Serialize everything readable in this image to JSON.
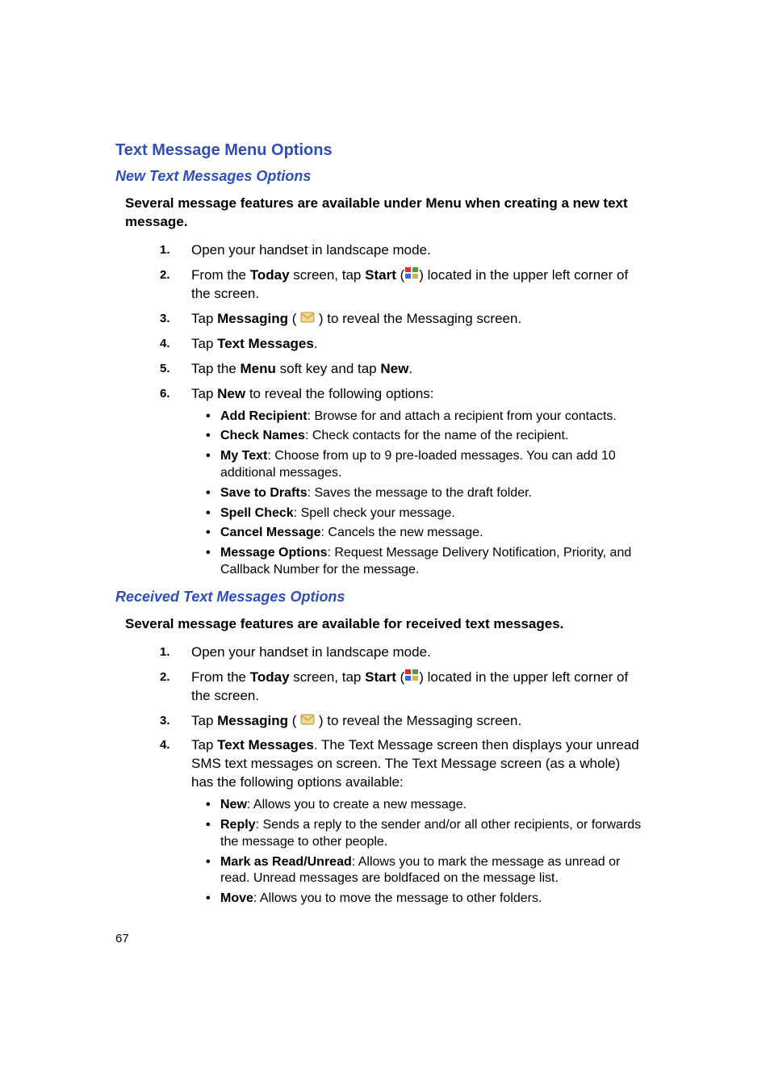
{
  "headings": {
    "main": "Text Message Menu Options",
    "sec1": "New Text Messages Options",
    "sec2": "Received Text Messages Options"
  },
  "intro": {
    "sec1": "Several message features are available under Menu when creating a new text message.",
    "sec2": "Several message features are available for received text messages."
  },
  "steps1": {
    "s1": "Open your handset in landscape mode.",
    "s2a": "From the ",
    "s2b": "Today",
    "s2c": " screen, tap ",
    "s2d": "Start",
    "s2e": " (",
    "s2f": ") located in the upper left corner of the screen.",
    "s3a": "Tap ",
    "s3b": "Messaging",
    "s3c": " ( ",
    "s3d": " ) to reveal the Messaging screen.",
    "s4a": "Tap ",
    "s4b": "Text Messages",
    "s4c": ".",
    "s5a": "Tap the ",
    "s5b": "Menu",
    "s5c": " soft key and tap ",
    "s5d": "New",
    "s5e": ".",
    "s6a": "Tap ",
    "s6b": "New",
    "s6c": " to reveal the following options:"
  },
  "bullets1": {
    "b1t": "Add Recipient",
    "b1d": ": Browse for and attach a recipient from your contacts.",
    "b2t": "Check Names",
    "b2d": ": Check contacts for the name of the recipient.",
    "b3t": "My Text",
    "b3d": ": Choose from up to 9 pre-loaded messages. You can add 10 additional messages.",
    "b4t": "Save to Drafts",
    "b4d": ": Saves the message to the draft folder.",
    "b5t": "Spell Check",
    "b5d": ": Spell check your message.",
    "b6t": "Cancel Message",
    "b6d": ": Cancels the new message.",
    "b7t": "Message Options",
    "b7d": ": Request Message Delivery Notification, Priority, and Callback Number for the message."
  },
  "steps2": {
    "s1": "Open your handset in landscape mode.",
    "s2a": "From the ",
    "s2b": "Today",
    "s2c": " screen, tap ",
    "s2d": "Start",
    "s2e": " (",
    "s2f": ") located in the upper left corner of the screen.",
    "s3a": "Tap ",
    "s3b": "Messaging",
    "s3c": " ( ",
    "s3d": " ) to reveal the Messaging screen.",
    "s4a": "Tap ",
    "s4b": "Text Messages",
    "s4c": ". The Text Message screen then displays your unread SMS text messages on screen. The Text Message screen (as a whole) has the following options available:"
  },
  "bullets2": {
    "b1t": "New",
    "b1d": ": Allows you to create a new message.",
    "b2t": "Reply",
    "b2d": ": Sends a reply to the sender and/or all other recipients, or forwards the message to other people.",
    "b3t": "Mark as Read/Unread",
    "b3d": ": Allows you to mark the message as unread or read. Unread messages are boldfaced on the message list.",
    "b4t": "Move",
    "b4d": ": Allows you to move the message to other folders."
  },
  "pagenum": "67"
}
